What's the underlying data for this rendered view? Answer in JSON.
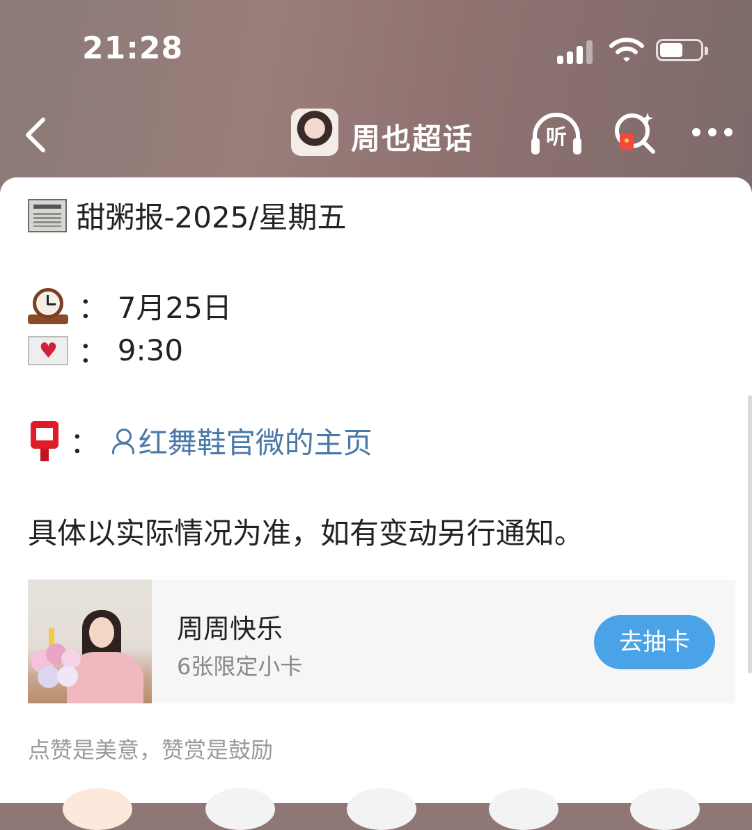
{
  "status_bar": {
    "time": "21:28"
  },
  "nav": {
    "title": "周也超话",
    "listen_label": "听"
  },
  "post": {
    "headline_text": "甜粥报-2025/星期五",
    "colon": "：",
    "date_value": "7月25日",
    "time_value": "9:30",
    "link_text": "红舞鞋官微的主页",
    "notice": "具体以实际情况为准，如有变动另行通知。"
  },
  "promo": {
    "title": "周周快乐",
    "subtitle": "6张限定小卡",
    "button_label": "去抽卡"
  },
  "footer": {
    "note": "点赞是美意，赞赏是鼓励"
  }
}
